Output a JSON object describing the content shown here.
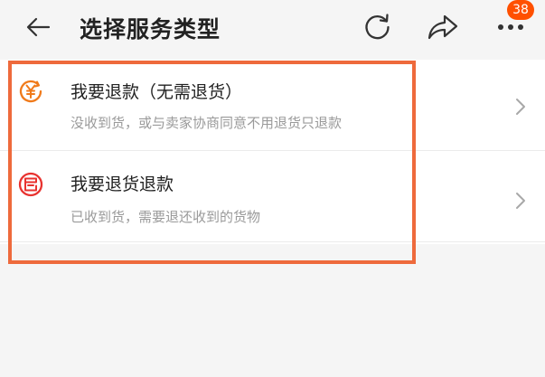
{
  "header": {
    "title": "选择服务类型",
    "icons": [
      "back-arrow-icon",
      "refresh-icon",
      "share-icon",
      "more-icon"
    ],
    "badge_count": "38"
  },
  "options": [
    {
      "title": "我要退款（无需退货）",
      "subtitle": "没收到货，或与卖家协商同意不用退货只退款",
      "icon": "refund-yen-icon"
    },
    {
      "title": "我要退货退款",
      "subtitle": "已收到货，需要退还收到的货物",
      "icon": "return-goods-icon"
    }
  ],
  "colors": {
    "accent": "#ff5000",
    "refund_icon": "#f07a1a",
    "return_icon": "#e8322f",
    "highlight_border": "#ee6a3c"
  }
}
